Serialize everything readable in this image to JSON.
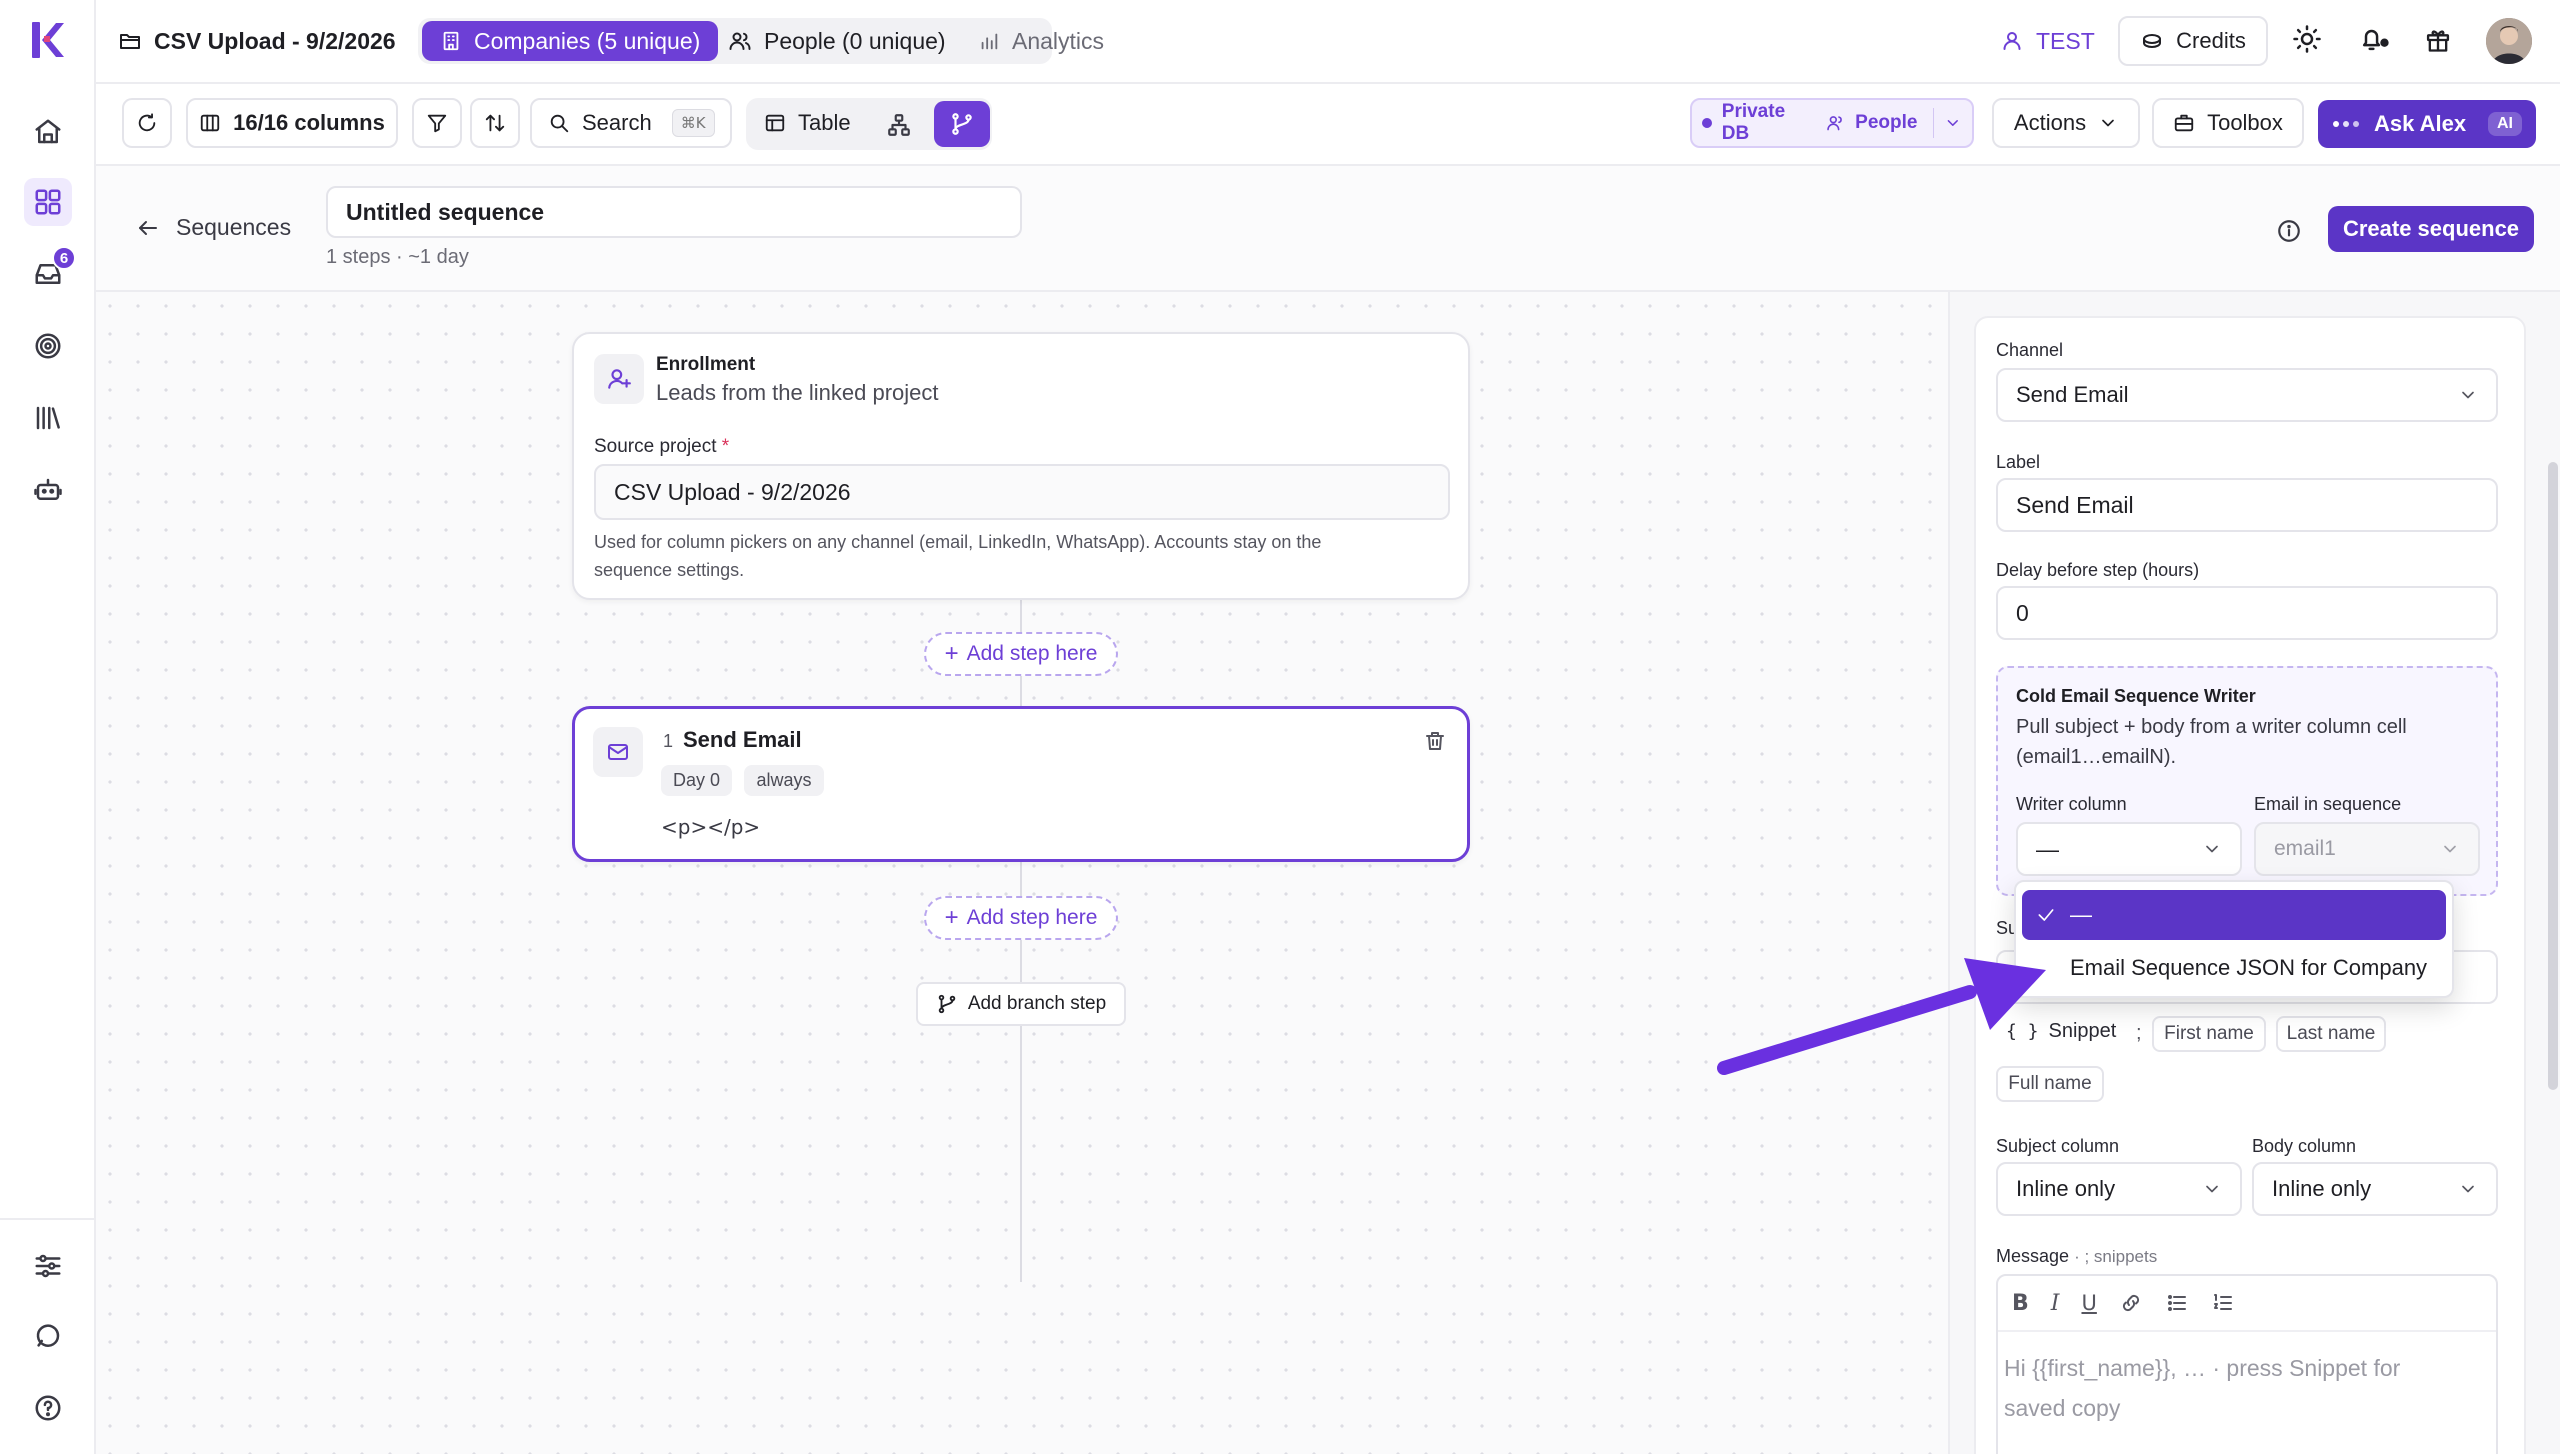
{
  "colors": {
    "accent": "#6d3fd6",
    "accent_dark": "#5b35c6",
    "accent_light": "#efeafd",
    "arrow": "#6a30e0"
  },
  "rail": {
    "logo": "K",
    "items": [
      {
        "icon": "home-icon"
      },
      {
        "icon": "grid-icon",
        "active": true
      },
      {
        "icon": "inbox-icon",
        "badge": "6"
      },
      {
        "icon": "target-icon"
      },
      {
        "icon": "library-icon"
      },
      {
        "icon": "robot-icon"
      }
    ],
    "bottom": [
      {
        "icon": "sliders-icon"
      },
      {
        "icon": "chat-icon"
      },
      {
        "icon": "help-icon"
      }
    ]
  },
  "topbar": {
    "project": "CSV Upload - 9/2/2026",
    "tabs": [
      {
        "label": "Companies (5 unique)",
        "active": true
      },
      {
        "label": "People (0 unique)"
      },
      {
        "label": "Analytics"
      }
    ],
    "workspace": "TEST",
    "credits": "Credits"
  },
  "toolbar": {
    "columns": "16/16 columns",
    "search": "Search",
    "search_kbd": "⌘K",
    "view_table": "Table",
    "db_label": "Private DB",
    "db_entity": "People",
    "actions": "Actions",
    "toolbox": "Toolbox",
    "ask": "Ask Alex",
    "ask_badge": "AI"
  },
  "header": {
    "back": "Sequences",
    "name": "Untitled sequence",
    "meta": "1 steps · ~1 day",
    "create": "Create sequence"
  },
  "enrollment": {
    "title": "Enrollment",
    "subtitle": "Leads from the linked project",
    "source_label": "Source project",
    "required": "*",
    "source_value": "CSV Upload - 9/2/2026",
    "help_line1": "Used for column pickers on any channel (email, LinkedIn, WhatsApp). Accounts stay on the",
    "help_line2": "sequence settings."
  },
  "add_step": "Add step here",
  "step": {
    "number": "1",
    "title": "Send Email",
    "day": "Day 0",
    "condition": "always",
    "body": "<p></p>"
  },
  "add_branch": "Add branch step",
  "panel": {
    "channel_label": "Channel",
    "channel_value": "Send Email",
    "label_label": "Label",
    "label_value": "Send Email",
    "delay_label": "Delay before step (hours)",
    "delay_value": "0",
    "writer": {
      "title": "Cold Email Sequence Writer",
      "desc_line1": "Pull subject + body from a writer column cell",
      "desc_line2": "(email1…emailN).",
      "writer_col_label": "Writer column",
      "writer_col_value": "—",
      "email_seq_label": "Email in sequence",
      "email_seq_value": "email1"
    },
    "subject_partial": "Su",
    "snippet": "Snippet",
    "snippet_sep": ";",
    "chips": [
      "First name",
      "Last name",
      "Full name"
    ],
    "subject_col_label": "Subject column",
    "subject_col_value": "Inline only",
    "body_col_label": "Body column",
    "body_col_value": "Inline only",
    "message_label": "Message",
    "message_hint": "· ; snippets",
    "message_placeholder_line1": "Hi {{first_name}}, …  ·  press Snippet for",
    "message_placeholder_line2": "saved copy"
  },
  "dropdown": {
    "options": [
      {
        "label": "—",
        "selected": true
      },
      {
        "label": "Email Sequence JSON for Company"
      }
    ]
  }
}
